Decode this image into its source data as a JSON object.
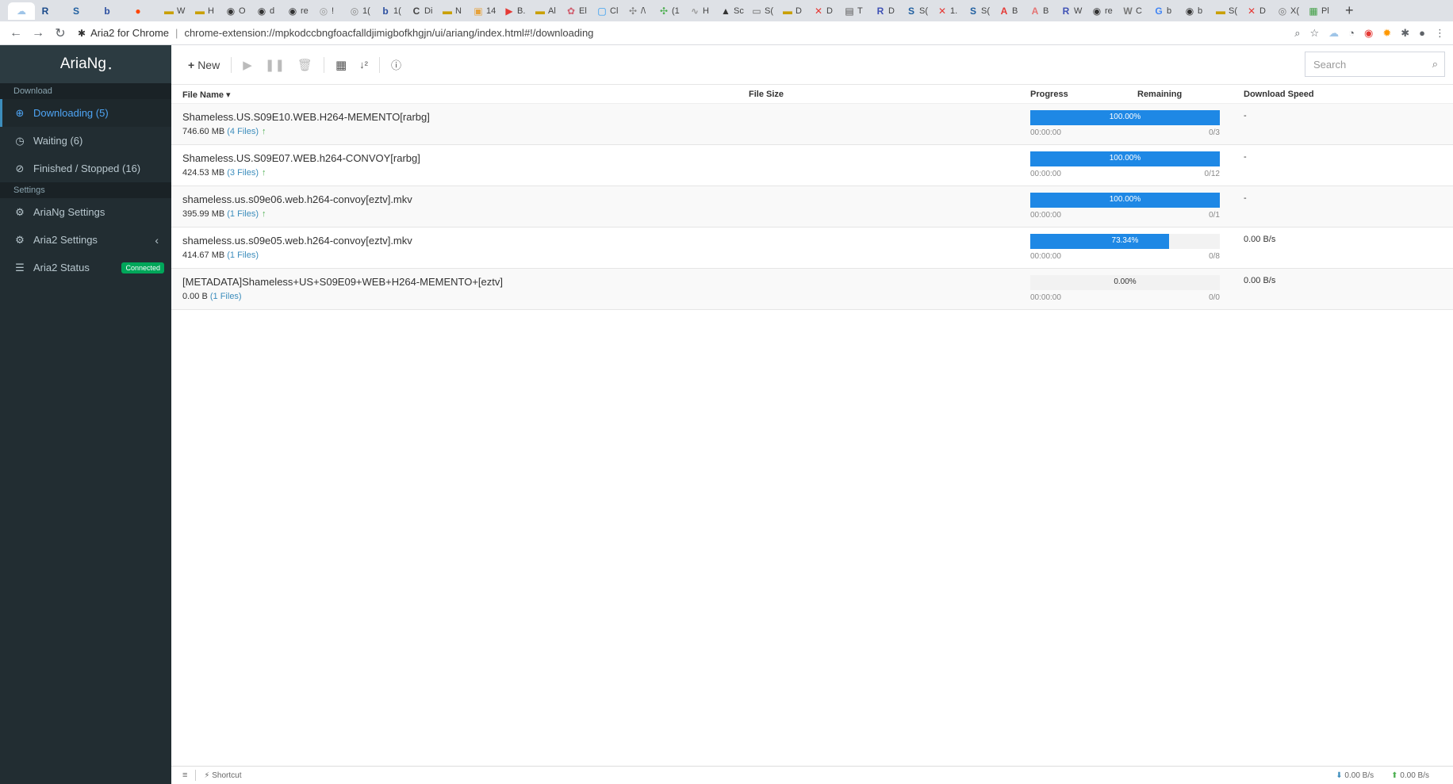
{
  "browser": {
    "tabs": [
      {
        "label": "",
        "color": "#9fc5e8",
        "glyph": "☁"
      },
      {
        "label": "",
        "color": "#1a4a8a",
        "glyph": "R"
      },
      {
        "label": "",
        "color": "#1f5fa0",
        "glyph": "S"
      },
      {
        "label": "",
        "color": "#2b4fa0",
        "glyph": "b"
      },
      {
        "label": "",
        "color": "#ff4500",
        "glyph": "●"
      },
      {
        "label": "W",
        "color": "#c9a000",
        "glyph": "▬"
      },
      {
        "label": "H",
        "color": "#c9a000",
        "glyph": "▬"
      },
      {
        "label": "O",
        "color": "#333333",
        "glyph": "◉"
      },
      {
        "label": "d",
        "color": "#333333",
        "glyph": "◉"
      },
      {
        "label": "re",
        "color": "#333333",
        "glyph": "◉"
      },
      {
        "label": "!",
        "color": "#999999",
        "glyph": "◎"
      },
      {
        "label": "1(",
        "color": "#888888",
        "glyph": "◎"
      },
      {
        "label": "1(",
        "color": "#2b4fa0",
        "glyph": "b"
      },
      {
        "label": "Di",
        "color": "#444444",
        "glyph": "C"
      },
      {
        "label": "N",
        "color": "#c9a000",
        "glyph": "▬"
      },
      {
        "label": "14",
        "color": "#e6a23c",
        "glyph": "▣"
      },
      {
        "label": "B.",
        "color": "#e53935",
        "glyph": "▶"
      },
      {
        "label": "Al",
        "color": "#c9a000",
        "glyph": "▬"
      },
      {
        "label": "El",
        "color": "#d06070",
        "glyph": "✿"
      },
      {
        "label": "Cl",
        "color": "#2196f3",
        "glyph": "▢"
      },
      {
        "label": "/\\",
        "color": "#888888",
        "glyph": "✣"
      },
      {
        "label": "(1",
        "color": "#4caf50",
        "glyph": "✣"
      },
      {
        "label": "H",
        "color": "#999999",
        "glyph": "∿"
      },
      {
        "label": "Sc",
        "color": "#333333",
        "glyph": "▲"
      },
      {
        "label": "S(",
        "color": "#666666",
        "glyph": "▭"
      },
      {
        "label": "D",
        "color": "#c9a000",
        "glyph": "▬"
      },
      {
        "label": "D",
        "color": "#e53935",
        "glyph": "✕"
      },
      {
        "label": "T",
        "color": "#555555",
        "glyph": "▤"
      },
      {
        "label": "D",
        "color": "#3f51b5",
        "glyph": "R"
      },
      {
        "label": "S(",
        "color": "#1f5fa0",
        "glyph": "S"
      },
      {
        "label": "1.",
        "color": "#e53935",
        "glyph": "✕"
      },
      {
        "label": "S(",
        "color": "#1f5fa0",
        "glyph": "S"
      },
      {
        "label": "B",
        "color": "#e53935",
        "glyph": "A"
      },
      {
        "label": "B",
        "color": "#e57373",
        "glyph": "A"
      },
      {
        "label": "W",
        "color": "#3f51b5",
        "glyph": "R"
      },
      {
        "label": "re",
        "color": "#333333",
        "glyph": "◉"
      },
      {
        "label": "C",
        "color": "#777777",
        "glyph": "W"
      },
      {
        "label": "b",
        "color": "#4285f4",
        "glyph": "G"
      },
      {
        "label": "b",
        "color": "#333333",
        "glyph": "◉"
      },
      {
        "label": "S(",
        "color": "#c9a000",
        "glyph": "▬"
      },
      {
        "label": "D",
        "color": "#e53935",
        "glyph": "✕"
      },
      {
        "label": "X(",
        "color": "#777777",
        "glyph": "◎"
      },
      {
        "label": "Pl",
        "color": "#43a047",
        "glyph": "▦"
      }
    ],
    "ext_label": "Aria2 for Chrome",
    "url": "chrome-extension://mpkodccbngfoacfalldjimigbofkhgjn/ui/ariang/index.html#!/downloading"
  },
  "sidebar": {
    "logo": "AriaNg",
    "sections": {
      "download": "Download",
      "settings": "Settings"
    },
    "items": [
      {
        "label": "Downloading (5)",
        "icon": "download-circle-icon"
      },
      {
        "label": "Waiting (6)",
        "icon": "clock-icon"
      },
      {
        "label": "Finished / Stopped (16)",
        "icon": "check-circle-icon"
      },
      {
        "label": "AriaNg Settings",
        "icon": "gear-icon"
      },
      {
        "label": "Aria2 Settings",
        "icon": "gears-icon"
      },
      {
        "label": "Aria2 Status",
        "icon": "server-icon",
        "badge": "Connected"
      }
    ]
  },
  "toolbar": {
    "new_label": "New",
    "search_placeholder": "Search"
  },
  "table": {
    "headers": {
      "name": "File Name",
      "size": "File Size",
      "progress": "Progress",
      "remaining": "Remaining",
      "speed": "Download Speed"
    },
    "rows": [
      {
        "name": "Shameless.US.S09E10.WEB.H264-MEMENTO[rarbg]",
        "size": "746.60 MB",
        "files": "(4 Files)",
        "seeding": true,
        "progress": 100.0,
        "progress_label": "100.00%",
        "time": "00:00:00",
        "connections": "0/3",
        "speed": "-"
      },
      {
        "name": "Shameless.US.S09E07.WEB.h264-CONVOY[rarbg]",
        "size": "424.53 MB",
        "files": "(3 Files)",
        "seeding": true,
        "progress": 100.0,
        "progress_label": "100.00%",
        "time": "00:00:00",
        "connections": "0/12",
        "speed": "-"
      },
      {
        "name": "shameless.us.s09e06.web.h264-convoy[eztv].mkv",
        "size": "395.99 MB",
        "files": "(1 Files)",
        "seeding": true,
        "progress": 100.0,
        "progress_label": "100.00%",
        "time": "00:00:00",
        "connections": "0/1",
        "speed": "-"
      },
      {
        "name": "shameless.us.s09e05.web.h264-convoy[eztv].mkv",
        "size": "414.67 MB",
        "files": "(1 Files)",
        "seeding": false,
        "progress": 73.34,
        "progress_label": "73.34%",
        "time": "00:00:00",
        "connections": "0/8",
        "speed": "0.00 B/s"
      },
      {
        "name": "[METADATA]Shameless+US+S09E09+WEB+H264-MEMENTO+[eztv]",
        "size": "0.00 B",
        "files": "(1 Files)",
        "seeding": false,
        "progress": 0.0,
        "progress_label": "0.00%",
        "time": "00:00:00",
        "connections": "0/0",
        "speed": "0.00 B/s"
      }
    ]
  },
  "footer": {
    "shortcut": "Shortcut",
    "download_speed": "0.00 B/s",
    "upload_speed": "0.00 B/s"
  },
  "colors": {
    "sidebar_bg": "#222d32",
    "accent": "#3c8dbc",
    "progress": "#1e88e5",
    "connected": "#00a65a"
  }
}
